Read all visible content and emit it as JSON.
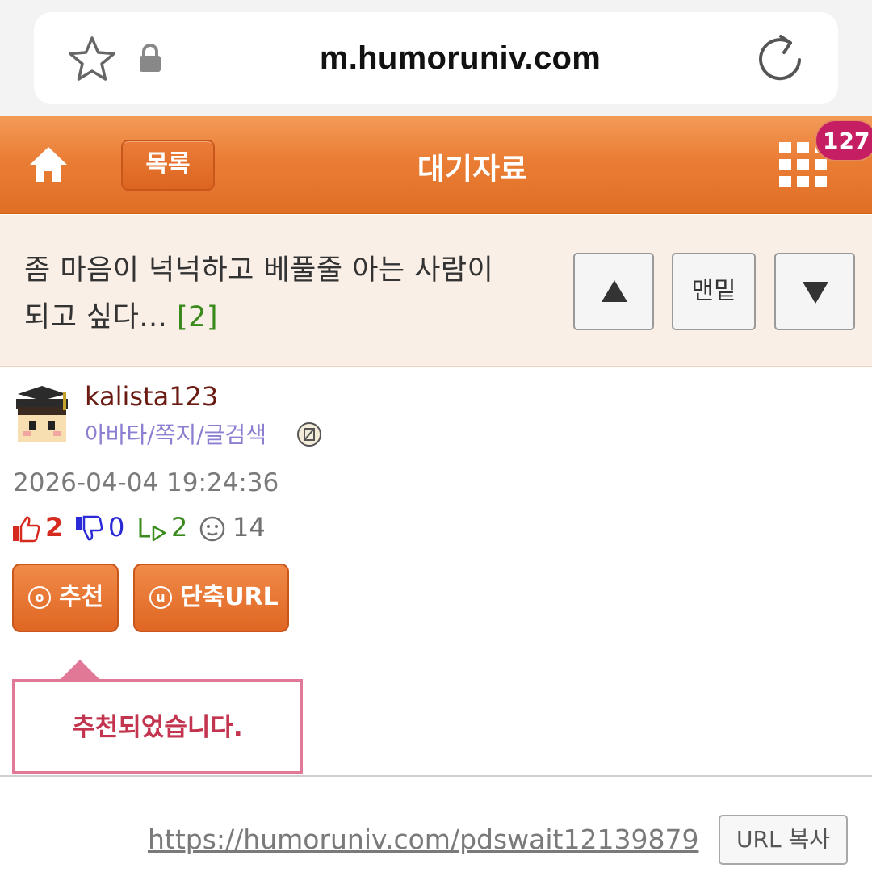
{
  "browser": {
    "url": "m.humoruniv.com"
  },
  "header": {
    "list_label": "목록",
    "title": "대기자료",
    "notification_count": "127"
  },
  "post": {
    "title": "좀 마음이 넉넉하고 베풀줄 아는 사람이 되고 싶다...",
    "comment_count": "[2]",
    "nav": {
      "bottom_label": "맨밑"
    }
  },
  "author": {
    "name": "kalista123",
    "links": "아바타/쪽지/글검색"
  },
  "date": "2026-04-04 19:24:36",
  "stats": {
    "upvotes": "2",
    "downvotes": "0",
    "replies": "2",
    "views": "14"
  },
  "actions": {
    "recommend_label": "추천",
    "recommend_icon": "ⓞ",
    "short_url_label": "단축URL",
    "short_url_icon": "u"
  },
  "toast": {
    "message": "추천되었습니다."
  },
  "footer": {
    "short_url": "https://humoruniv.com/pdswait12139879",
    "copy_label": "URL 복사"
  },
  "colors": {
    "accent_orange": "#e06f25",
    "badge": "#c51e62",
    "toast_border": "#e07896",
    "toast_text": "#c3344e"
  }
}
